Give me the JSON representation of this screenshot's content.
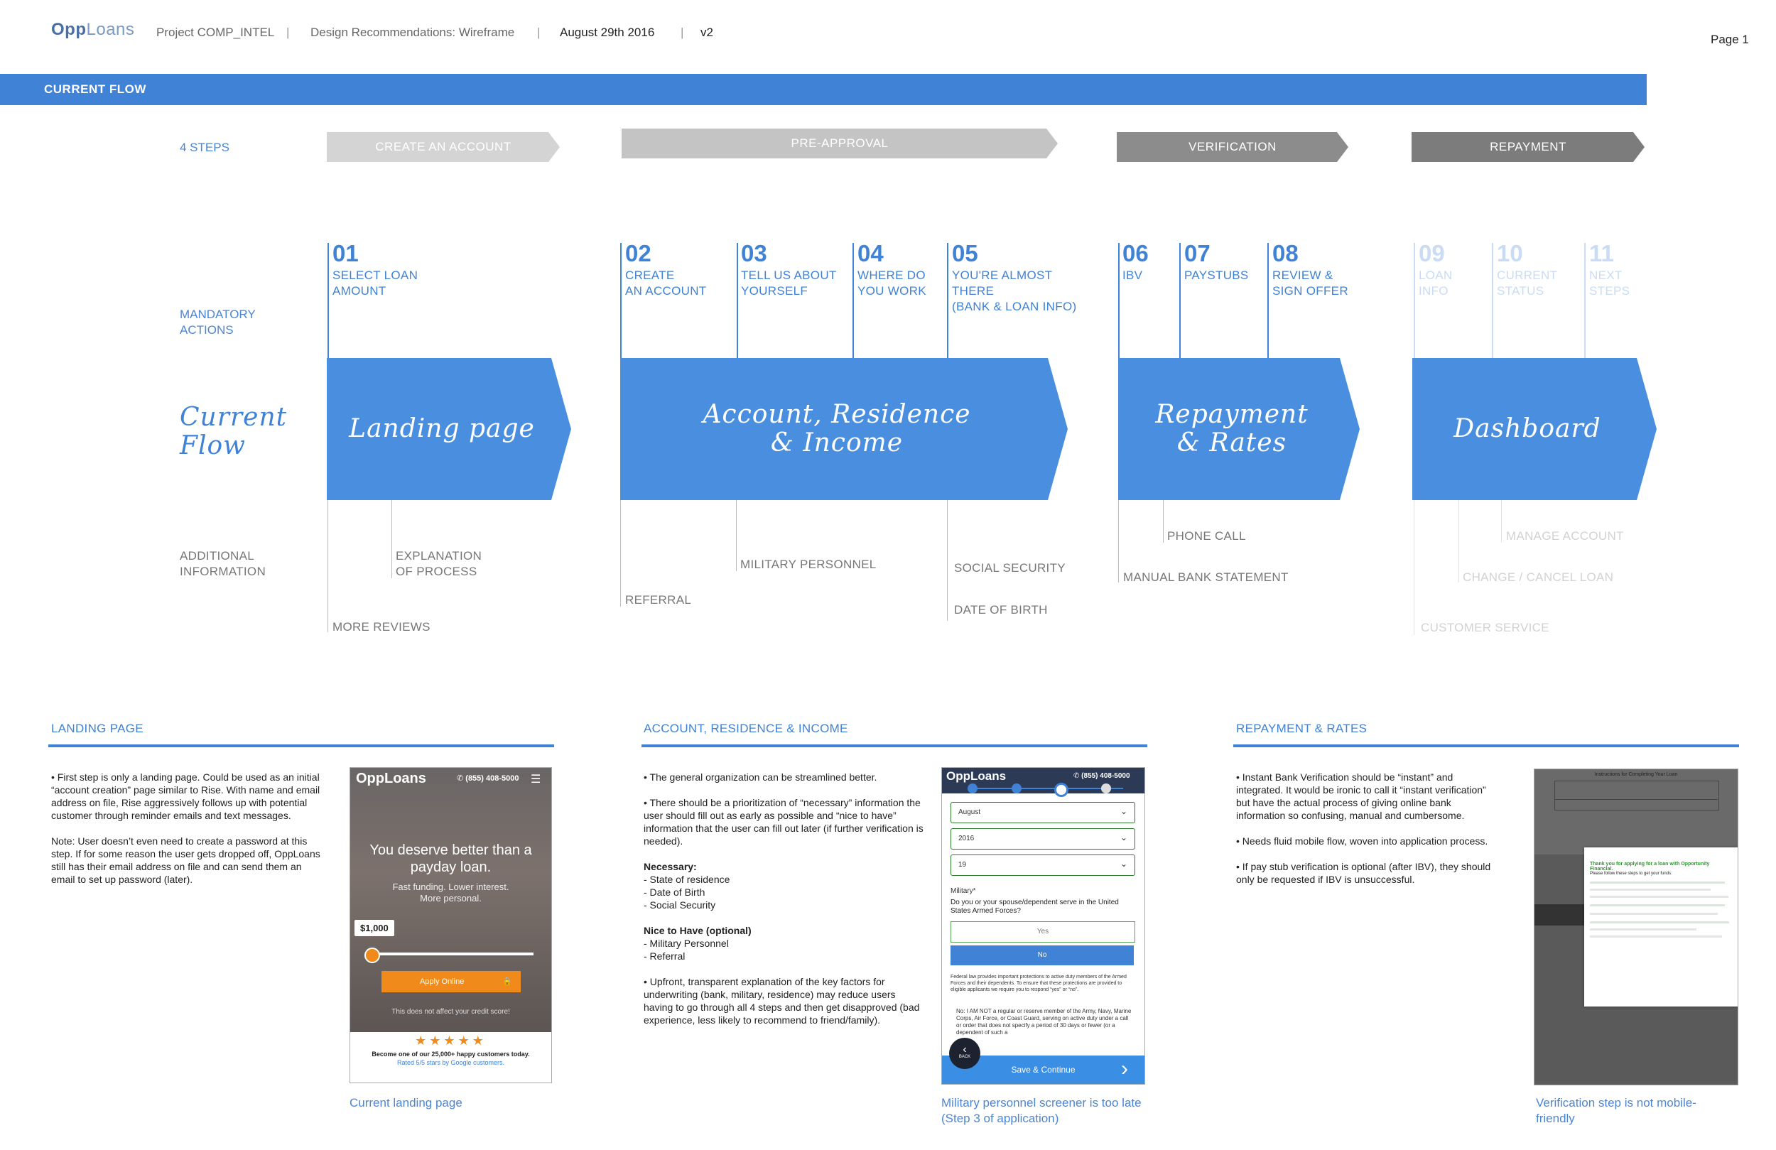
{
  "header": {
    "logo_main": "Opp",
    "logo_sub": "Loans",
    "project": "Project COMP_INTEL",
    "doc_title": "Design Recommendations: Wireframe",
    "date": "August 29th  2016",
    "version": "v2",
    "page": "Page 1",
    "separator": "|"
  },
  "band": {
    "label": "CURRENT FLOW"
  },
  "row_labels": {
    "steps": "4 STEPS",
    "mandatory": "MANDATORY\nACTIONS",
    "current_flow": "Current\nFlow",
    "additional": "ADDITIONAL\nINFORMATION"
  },
  "phases": [
    {
      "label": "CREATE AN ACCOUNT",
      "color": "#d4d4d4"
    },
    {
      "label": "PRE-APPROVAL",
      "color": "#c4c4c4"
    },
    {
      "label": "VERIFICATION",
      "color": "#8c8c8c"
    },
    {
      "label": "REPAYMENT",
      "color": "#7c7c7c"
    }
  ],
  "actions": [
    {
      "num": "01",
      "label": "SELECT LOAN\nAMOUNT"
    },
    {
      "num": "02",
      "label": "CREATE\nAN ACCOUNT"
    },
    {
      "num": "03",
      "label": "TELL US ABOUT\nYOURSELF"
    },
    {
      "num": "04",
      "label": "WHERE DO\nYOU WORK"
    },
    {
      "num": "05",
      "label": "YOU'RE ALMOST\nTHERE",
      "sub": "(BANK & LOAN INFO)"
    },
    {
      "num": "06",
      "label": "IBV"
    },
    {
      "num": "07",
      "label": "PAYSTUBS"
    },
    {
      "num": "08",
      "label": "REVIEW &\nSIGN OFFER"
    },
    {
      "num": "09",
      "label": "LOAN\nINFO"
    },
    {
      "num": "10",
      "label": "CURRENT\nSTATUS"
    },
    {
      "num": "11",
      "label": "NEXT\nSTEPS"
    }
  ],
  "flow": [
    {
      "label": "Landing page"
    },
    {
      "label": "Account, Residence\n& Income"
    },
    {
      "label": "Repayment\n& Rates"
    },
    {
      "label": "Dashboard"
    }
  ],
  "additional": {
    "explanation": "EXPLANATION\nOF PROCESS",
    "more_reviews": "MORE REVIEWS",
    "military": "MILITARY PERSONNEL",
    "referral": "REFERRAL",
    "social": "SOCIAL SECURITY",
    "dob": "DATE OF BIRTH",
    "phone_call": "PHONE CALL",
    "bank_statement": "MANUAL BANK STATEMENT",
    "manage": "MANAGE ACCOUNT",
    "change_cancel": "CHANGE / CANCEL LOAN",
    "customer_service": "CUSTOMER SERVICE"
  },
  "sections": {
    "landing": {
      "title": "LANDING PAGE",
      "p1": "• First step is only a landing page. Could be used as an initial “account creation” page similar to Rise. With name and email address on file, Rise aggressively follows up with potential customer through reminder emails and text messages.",
      "p2": "Note: User doesn’t even need to create a password at this step. If for some reason the user gets dropped off, OppLoans still has their email address on file and can send them an email to set up password (later).",
      "caption": "Current landing page",
      "phone": {
        "logo": "OppLoans",
        "tel": "(855) 408-5000",
        "headline": "You deserve better than a payday loan.",
        "sub": "Fast funding. Lower interest.\nMore personal.",
        "amount": "$1,000",
        "cta": "Apply Online",
        "note": "This does not affect your credit score!",
        "stars": "★★★★★",
        "review": "Become one of our 25,000+ happy customers today.",
        "rated": "Rated 5/5 stars by Google customers."
      }
    },
    "account": {
      "title": "ACCOUNT, RESIDENCE & INCOME",
      "p1": "• The general organization can be streamlined better.",
      "p2": "• There should be a prioritization of “necessary” information the user should fill out as early as possible and “nice to have” information that the user can fill out later (if further verification is needed).",
      "necessary_title": "Necessary:",
      "necessary": "- State of residence\n- Date of Birth\n- Social Security",
      "nice_title": "Nice to Have (optional)",
      "nice": "- Military Personnel\n- Referral",
      "p3": "• Upfront, transparent explanation of the key factors for underwriting (bank, military, residence) may reduce users having to go through all 4 steps and then get disapproved (bad experience, less likely to recommend to friend/family).",
      "caption": "Military personnel screener is too late (Step 3 of application)",
      "phone": {
        "logo": "OppLoans",
        "tel": "(855) 408-5000",
        "month": "August",
        "year": "2016",
        "day": "19",
        "military_label": "Military*",
        "question": "Do you or your spouse/dependent serve in the United States Armed Forces?",
        "yes": "Yes",
        "no": "No",
        "legal": "Federal law provides important protections to active duty members of the Armed Forces and their dependents. To ensure that these protections are provided to eligible applicants we require you to respond “yes” or “no”.",
        "no_detail": "No: I AM NOT a regular or reserve member of the Army, Navy, Marine Corps, Air Force, or Coast Guard, serving on active duty under a call or order that does not specify a period of 30 days or fewer (or a dependent of such a",
        "back": "BACK",
        "save": "Save & Continue",
        "chev": "›",
        "back_arrow": "‹"
      }
    },
    "repayment": {
      "title": "REPAYMENT & RATES",
      "p1": "• Instant Bank Verification should be “instant” and integrated. It would be ironic to call it “instant verification” but have the actual process of giving online bank information so confusing, manual and cumbersome.",
      "p2": "• Needs fluid mobile flow, woven into application process.",
      "p3": "• If pay stub verification is optional (after IBV), they should only be requested if IBV is unsuccessful.",
      "caption": "Verification step is not mobile-friendly",
      "phone": {
        "doc_title": "Instructions for Completing Your Loan",
        "thanks": "Thank you for applying for a loan with Opportunity Financial.",
        "follow": "Please follow these steps to get your funds:"
      }
    }
  }
}
